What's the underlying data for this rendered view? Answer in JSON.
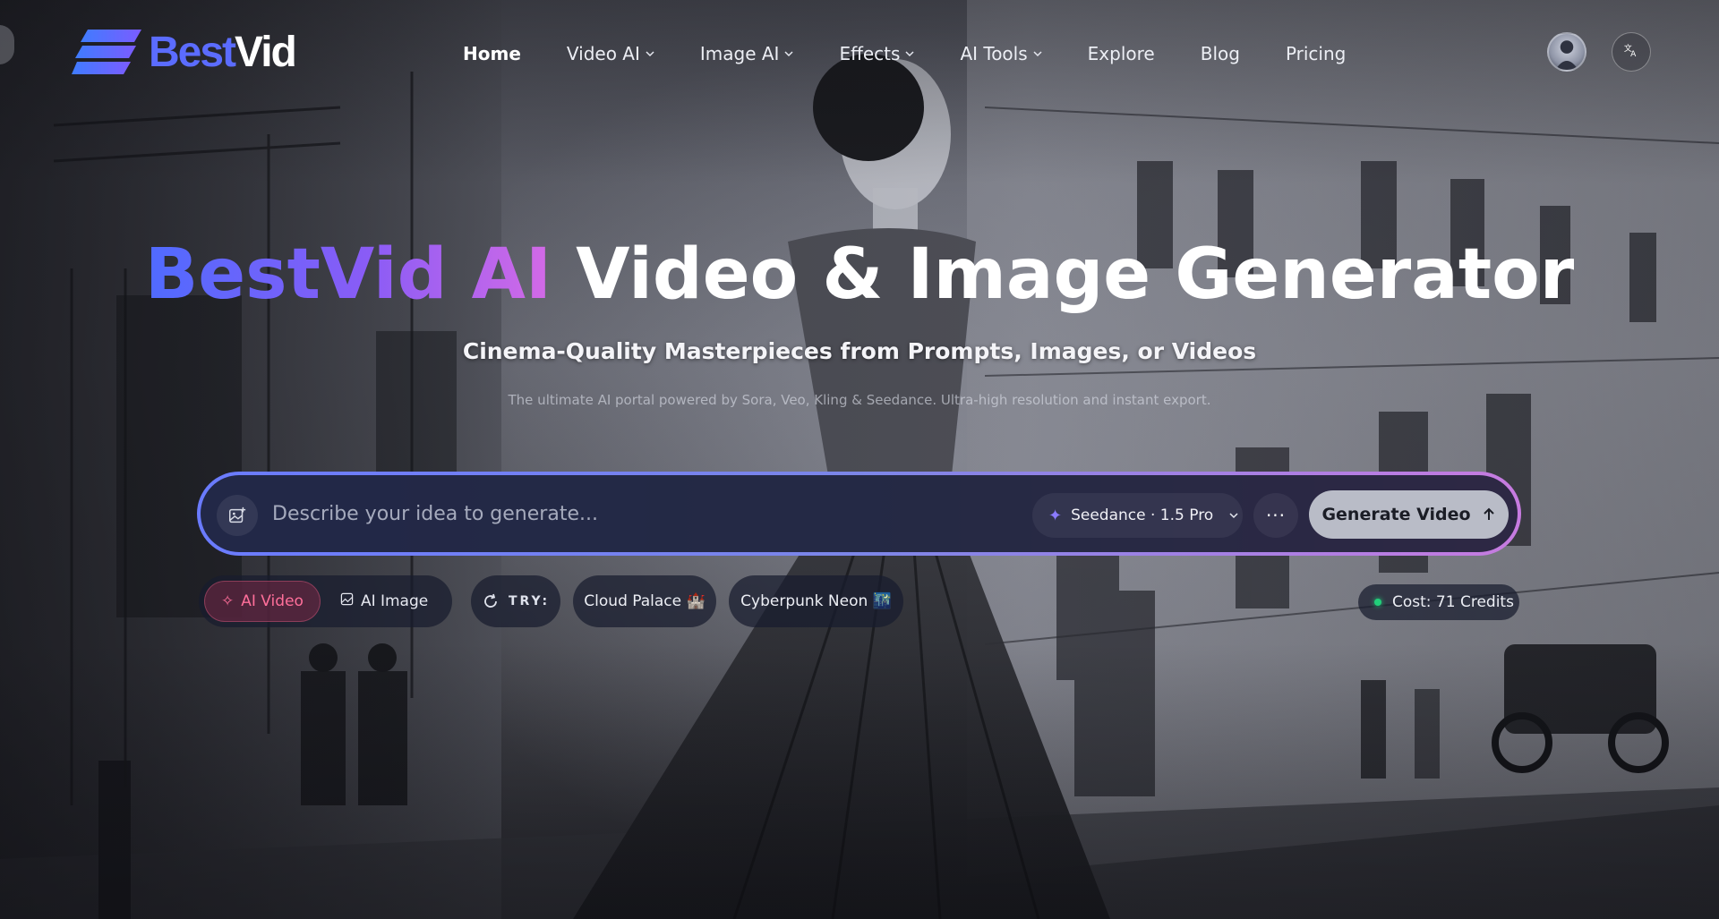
{
  "brand": {
    "logo_best": "Best",
    "logo_vid": "Vid",
    "accent": "#5b6cff",
    "gradient_start": "#4f6bff",
    "gradient_end": "#d46ae6"
  },
  "nav": {
    "items": [
      {
        "label": "Home",
        "dropdown": false,
        "active": true
      },
      {
        "label": "Video AI",
        "dropdown": true,
        "active": false
      },
      {
        "label": "Image AI",
        "dropdown": true,
        "active": false
      },
      {
        "label": "Effects",
        "dropdown": true,
        "active": false
      },
      {
        "label": "AI Tools",
        "dropdown": true,
        "active": false
      },
      {
        "label": "Explore",
        "dropdown": false,
        "active": false
      },
      {
        "label": "Blog",
        "dropdown": false,
        "active": false
      },
      {
        "label": "Pricing",
        "dropdown": false,
        "active": false
      }
    ],
    "language_icon": "translate-icon",
    "avatar_icon": "user-avatar"
  },
  "hero": {
    "title_brand": "BestVid AI",
    "title_rest": "Video & Image Generator",
    "subtitle": "Cinema-Quality Masterpieces from Prompts, Images, or Videos",
    "description": "The ultimate AI portal powered by Sora, Veo, Kling & Seedance. Ultra-high resolution and instant export."
  },
  "prompt": {
    "placeholder": "Describe your idea to generate...",
    "value": "",
    "model_label": "Seedance · 1.5 Pro",
    "more_label": "···",
    "generate_label": "Generate Video"
  },
  "modes": [
    {
      "label": "AI Video",
      "icon": "sparkle-icon",
      "active": true
    },
    {
      "label": "AI Image",
      "icon": "image-icon",
      "active": false
    }
  ],
  "try": {
    "label": "TRY:",
    "suggestions": [
      "Cloud Palace 🏰",
      "Cyberpunk Neon 🌃"
    ]
  },
  "cost": {
    "label": "Cost: 71 Credits",
    "status_color": "#21d07a"
  }
}
